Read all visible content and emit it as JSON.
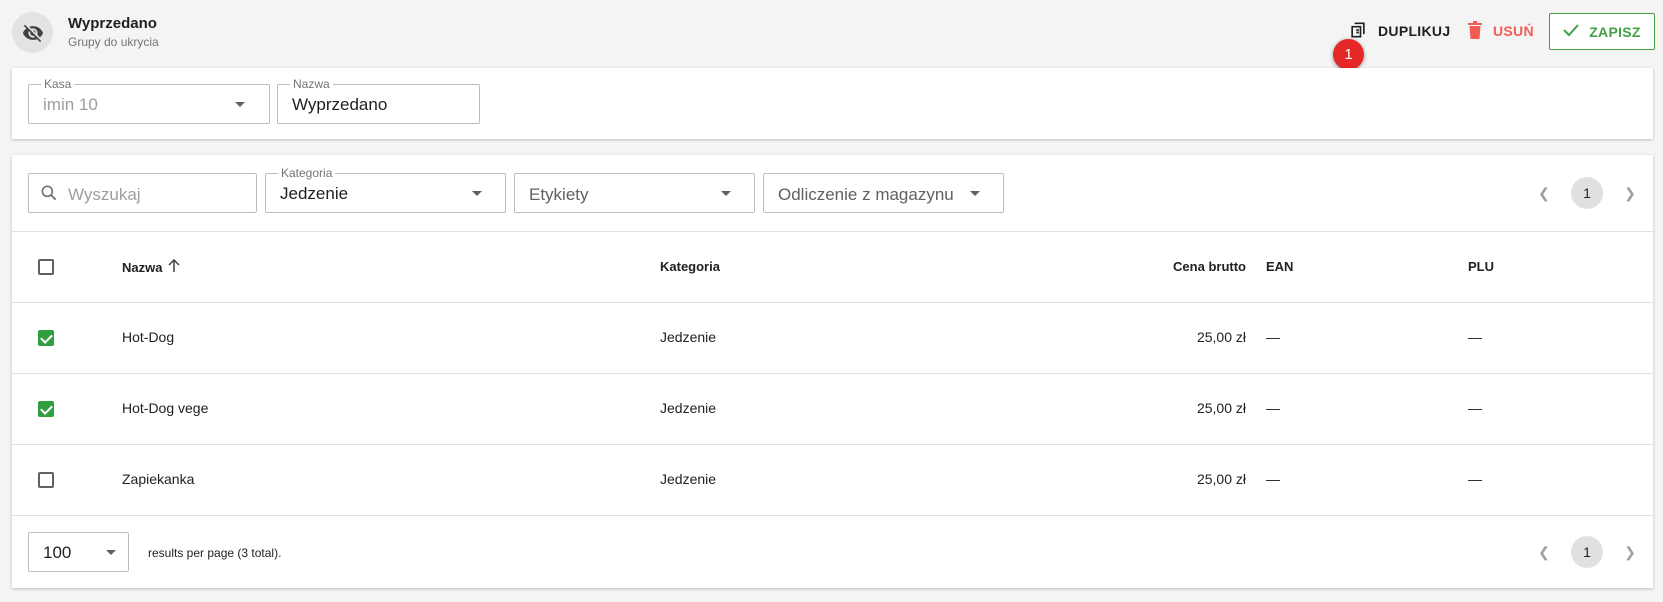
{
  "header": {
    "title": "Wyprzedano",
    "subtitle": "Grupy do ukrycia",
    "icon": "eye-off-icon"
  },
  "toolbar": {
    "duplicate_label": "DUPLIKUJ",
    "delete_label": "USUŃ",
    "save_label": "ZAPISZ",
    "badge_count": "1"
  },
  "form": {
    "kasa": {
      "label": "Kasa",
      "value": "imin 10"
    },
    "nazwa": {
      "label": "Nazwa",
      "value": "Wyprzedano"
    }
  },
  "filters": {
    "search_placeholder": "Wyszukaj",
    "kategoria": {
      "label": "Kategoria",
      "value": "Jedzenie"
    },
    "etykiety_placeholder": "Etykiety",
    "odliczenie_placeholder": "Odliczenie z magazynu"
  },
  "pagination": {
    "current_page": "1"
  },
  "table": {
    "columns": {
      "name": "Nazwa",
      "category": "Kategoria",
      "price": "Cena brutto",
      "ean": "EAN",
      "plu": "PLU"
    },
    "rows": [
      {
        "checked": true,
        "name": "Hot-Dog",
        "category": "Jedzenie",
        "price": "25,00 zł",
        "ean": "—",
        "plu": "—"
      },
      {
        "checked": true,
        "name": "Hot-Dog vege",
        "category": "Jedzenie",
        "price": "25,00 zł",
        "ean": "—",
        "plu": "—"
      },
      {
        "checked": false,
        "name": "Zapiekanka",
        "category": "Jedzenie",
        "price": "25,00 zł",
        "ean": "—",
        "plu": "—"
      }
    ]
  },
  "footer": {
    "per_page": "100",
    "results_text": "results per page (3 total)."
  },
  "colors": {
    "accent_green": "#43a047",
    "checkbox_green": "#2e9e3e",
    "delete_red": "#f25c54",
    "badge_red": "#e62727"
  }
}
